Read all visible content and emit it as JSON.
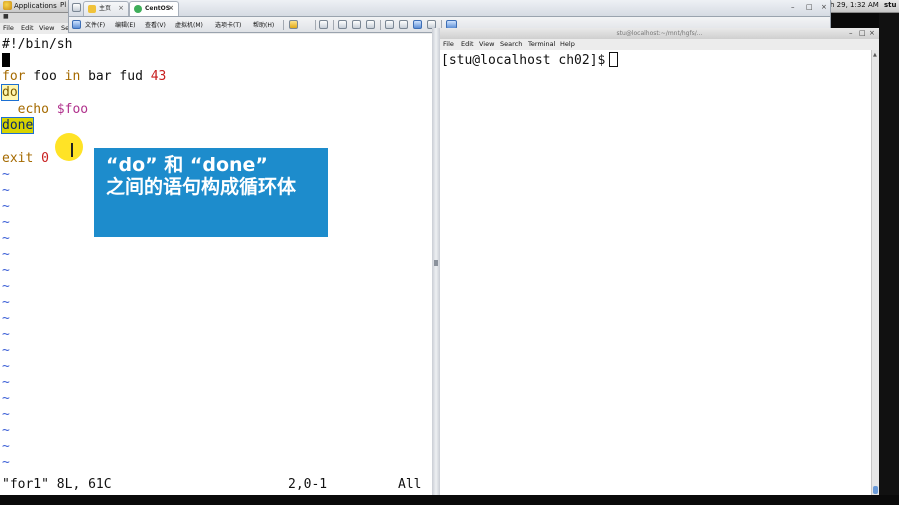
{
  "top_panel": {
    "applications": "Applications",
    "places": "Pl",
    "clock": "h 29,  1:32 AM",
    "user": "stu"
  },
  "vmware": {
    "tabs": [
      {
        "label": "主页",
        "close": "×"
      },
      {
        "label": "CentOS",
        "close": "×"
      }
    ],
    "menu": [
      "文件(F)",
      "编辑(E)",
      "查看(V)",
      "虚拟机(M)",
      "选项卡(T)",
      "帮助(H)"
    ]
  },
  "gvim": {
    "menu": [
      "File",
      "Edit",
      "View",
      "Se"
    ],
    "lines": {
      "shebang": "#!/bin/sh",
      "for_kw": "for",
      "for_rest": " foo ",
      "in_kw": "in",
      "for_list": " bar fud ",
      "for_num": "43",
      "do": "do",
      "echo_indent": "  echo ",
      "echo_var": "$foo",
      "done": "done",
      "exit_kw": "exit",
      "exit_num": "0"
    },
    "tilde": "~",
    "status": {
      "file": "\"for1\" 8L, 61C",
      "position": "2,0-1",
      "scroll": "All"
    }
  },
  "callout": {
    "line1": "“do”  和  “done”",
    "line2": "之间的语句构成循环体"
  },
  "terminal": {
    "title": "stu@localhost:~/mnt/hgfs/...",
    "menu": [
      "File",
      "Edit",
      "View",
      "Search",
      "Terminal",
      "Help"
    ],
    "prompt": "[stu@localhost ch02]$"
  },
  "colors": {
    "callout_bg": "#1d8ccc",
    "keyword": "#a56a00",
    "number": "#c81e1e",
    "tilde": "#3b5fd6",
    "done_highlight": "#d8d400"
  }
}
